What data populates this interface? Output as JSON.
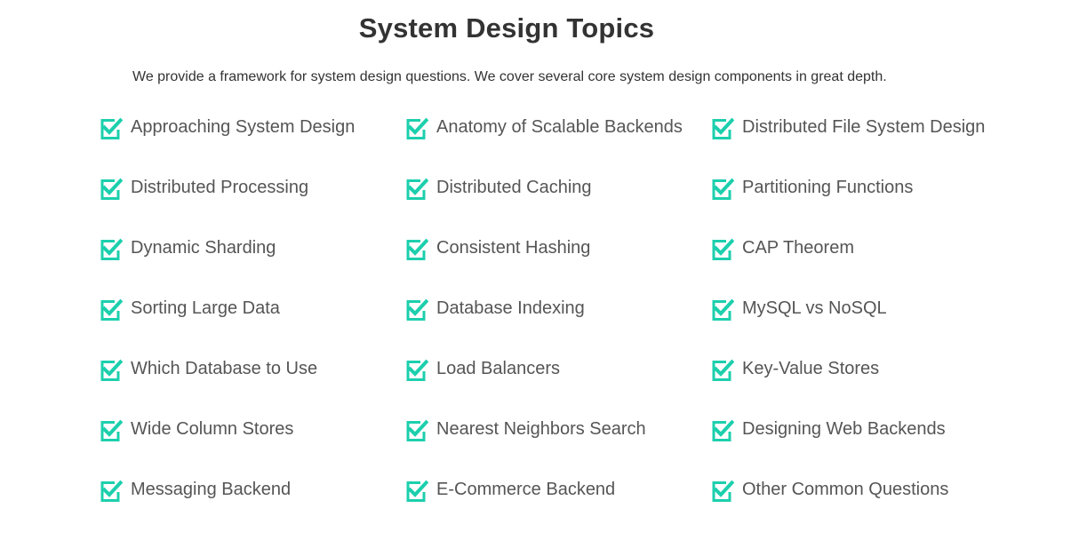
{
  "header": {
    "title": "System Design Topics",
    "intro": "We provide a framework for system design questions. We cover several core system design components in great depth."
  },
  "colors": {
    "accent": "#1ccfad"
  },
  "icon": "checkbox-checked-icon",
  "topics": [
    "Approaching System Design",
    "Anatomy of Scalable Backends",
    "Distributed File System Design",
    "Distributed Processing",
    "Distributed Caching",
    "Partitioning Functions",
    "Dynamic Sharding",
    "Consistent Hashing",
    "CAP Theorem",
    "Sorting Large Data",
    "Database Indexing",
    "MySQL vs NoSQL",
    "Which Database to Use",
    "Load Balancers",
    "Key-Value Stores",
    "Wide Column Stores",
    "Nearest Neighbors Search",
    "Designing Web Backends",
    "Messaging Backend",
    "E-Commerce Backend",
    "Other Common Questions"
  ]
}
